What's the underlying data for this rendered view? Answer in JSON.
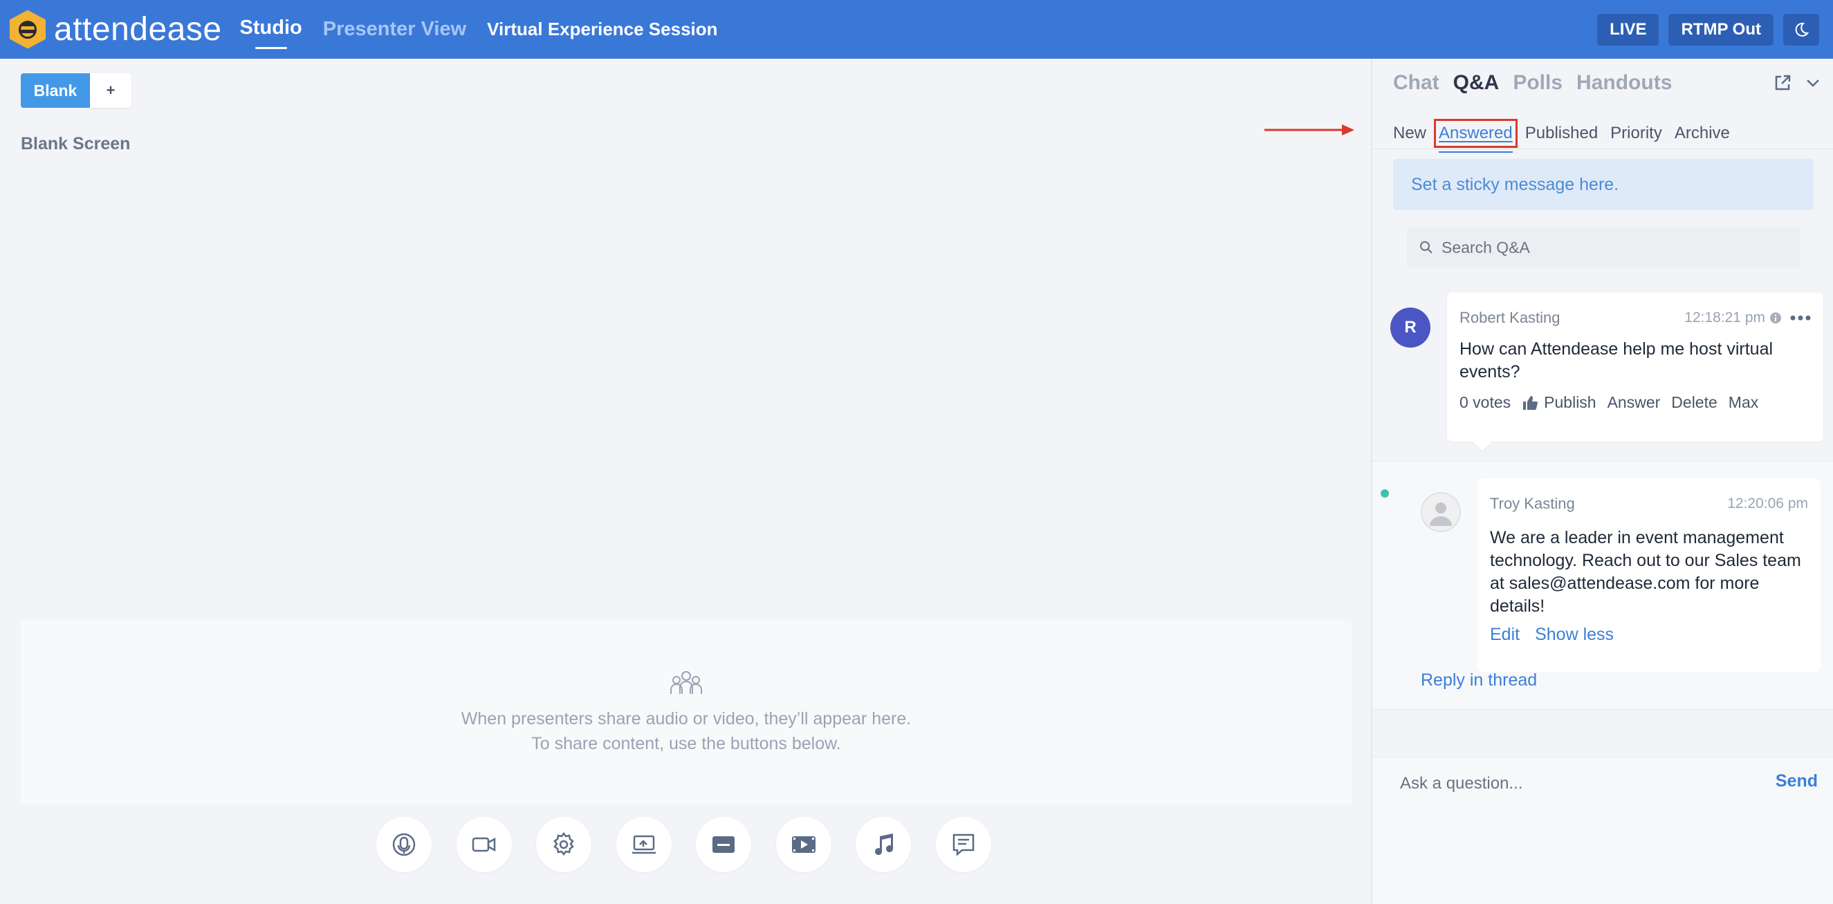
{
  "brand": {
    "logo_text": "attendease"
  },
  "header": {
    "nav_studio": "Studio",
    "nav_presenter": "Presenter View",
    "session_title": "Virtual Experience Session",
    "live_label": "LIVE",
    "rtmp_label": "RTMP Out",
    "theme_icon": "moon-icon"
  },
  "scenes": {
    "active_label": "Blank",
    "add_label": "+",
    "screen_title": "Blank Screen"
  },
  "presenters": {
    "line1": "When presenters share audio or video, they’ll appear here.",
    "line2": "To share content, use the buttons below."
  },
  "toolbar_icons": [
    "microphone-icon",
    "camera-icon",
    "settings-icon",
    "screen-share-icon",
    "banner-icon",
    "video-icon",
    "music-icon",
    "message-icon"
  ],
  "panel": {
    "tabs": [
      "Chat",
      "Q&A",
      "Polls",
      "Handouts"
    ],
    "active_tab": "Q&A",
    "sub_tabs": [
      "New",
      "Answered",
      "Published",
      "Priority",
      "Archive"
    ],
    "active_sub_tab": "Answered",
    "sticky_placeholder": "Set a sticky message here.",
    "search_placeholder": "Search Q&A",
    "question": {
      "avatar_initial": "R",
      "author": "Robert Kasting",
      "time": "12:18:21 pm",
      "body": "How can Attendease help me host virtual events?",
      "votes": "0 votes",
      "actions": [
        "Publish",
        "Answer",
        "Delete",
        "Max"
      ]
    },
    "answer": {
      "author": "Troy Kasting",
      "time": "12:20:06 pm",
      "body": "We are a leader in event management technology. Reach out to our Sales team at sales@attendease.com for more details!",
      "edit": "Edit",
      "show_less": "Show less"
    },
    "reply_in_thread": "Reply in thread",
    "ask_placeholder": "Ask a question...",
    "send_label": "Send"
  },
  "colors": {
    "header_bg": "#3a78d8",
    "accent": "#3a7fd8",
    "highlight": "#d93a2b",
    "avatar": "#4b55c4",
    "online": "#3fc0ac"
  }
}
